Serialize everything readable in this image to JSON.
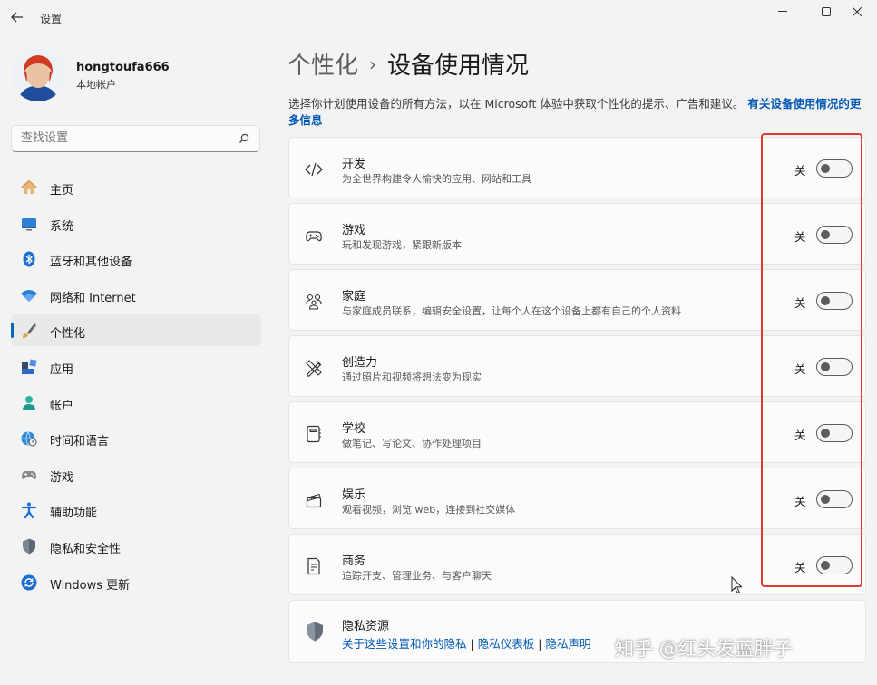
{
  "app": {
    "title": "设置"
  },
  "user": {
    "name": "hongtoufa666",
    "account_type": "本地帐户"
  },
  "search": {
    "placeholder": "查找设置"
  },
  "sidebar": {
    "items": [
      {
        "label": "主页",
        "icon": "home-icon"
      },
      {
        "label": "系统",
        "icon": "monitor-icon"
      },
      {
        "label": "蓝牙和其他设备",
        "icon": "bluetooth-icon"
      },
      {
        "label": "网络和 Internet",
        "icon": "wifi-icon"
      },
      {
        "label": "个性化",
        "icon": "brush-icon",
        "active": true
      },
      {
        "label": "应用",
        "icon": "apps-icon"
      },
      {
        "label": "帐户",
        "icon": "account-icon"
      },
      {
        "label": "时间和语言",
        "icon": "globe-clock-icon"
      },
      {
        "label": "游戏",
        "icon": "gamepad-icon"
      },
      {
        "label": "辅助功能",
        "icon": "accessibility-icon"
      },
      {
        "label": "隐私和安全性",
        "icon": "shield-icon"
      },
      {
        "label": "Windows 更新",
        "icon": "update-icon"
      }
    ]
  },
  "main": {
    "breadcrumb_parent": "个性化",
    "breadcrumb_separator": "›",
    "page_title": "设备使用情况",
    "description": "选择你计划使用设备的所有方法，以在 Microsoft 体验中获取个性化的提示、广告和建议。",
    "description_link": "有关设备使用情况的更多信息",
    "cards": [
      {
        "title": "开发",
        "subtitle": "为全世界构建令人愉快的应用、网站和工具",
        "toggle_label": "关",
        "toggle_on": false,
        "icon": "code-icon"
      },
      {
        "title": "游戏",
        "subtitle": "玩和发现游戏，紧跟新版本",
        "toggle_label": "关",
        "toggle_on": false,
        "icon": "gamepad-icon"
      },
      {
        "title": "家庭",
        "subtitle": "与家庭成员联系，编辑安全设置，让每个人在这个设备上都有自己的个人资料",
        "toggle_label": "关",
        "toggle_on": false,
        "icon": "family-icon"
      },
      {
        "title": "创造力",
        "subtitle": "通过照片和视频将想法变为现实",
        "toggle_label": "关",
        "toggle_on": false,
        "icon": "pen-ruler-icon"
      },
      {
        "title": "学校",
        "subtitle": "做笔记、写论文、协作处理项目",
        "toggle_label": "关",
        "toggle_on": false,
        "icon": "notebook-icon"
      },
      {
        "title": "娱乐",
        "subtitle": "观看视频，浏览 web，连接到社交媒体",
        "toggle_label": "关",
        "toggle_on": false,
        "icon": "clapperboard-icon"
      },
      {
        "title": "商务",
        "subtitle": "追踪开支、管理业务、与客户聊天",
        "toggle_label": "关",
        "toggle_on": false,
        "icon": "document-icon"
      }
    ],
    "privacy": {
      "title": "隐私资源",
      "links": [
        "关于这些设置和你的隐私",
        "隐私仪表板",
        "隐私声明"
      ],
      "separator": "|"
    }
  },
  "watermark": "知乎 @红头发蓝胖子",
  "colors": {
    "accent": "#0067c0",
    "link": "#0058b3",
    "highlight": "#e03a30"
  }
}
